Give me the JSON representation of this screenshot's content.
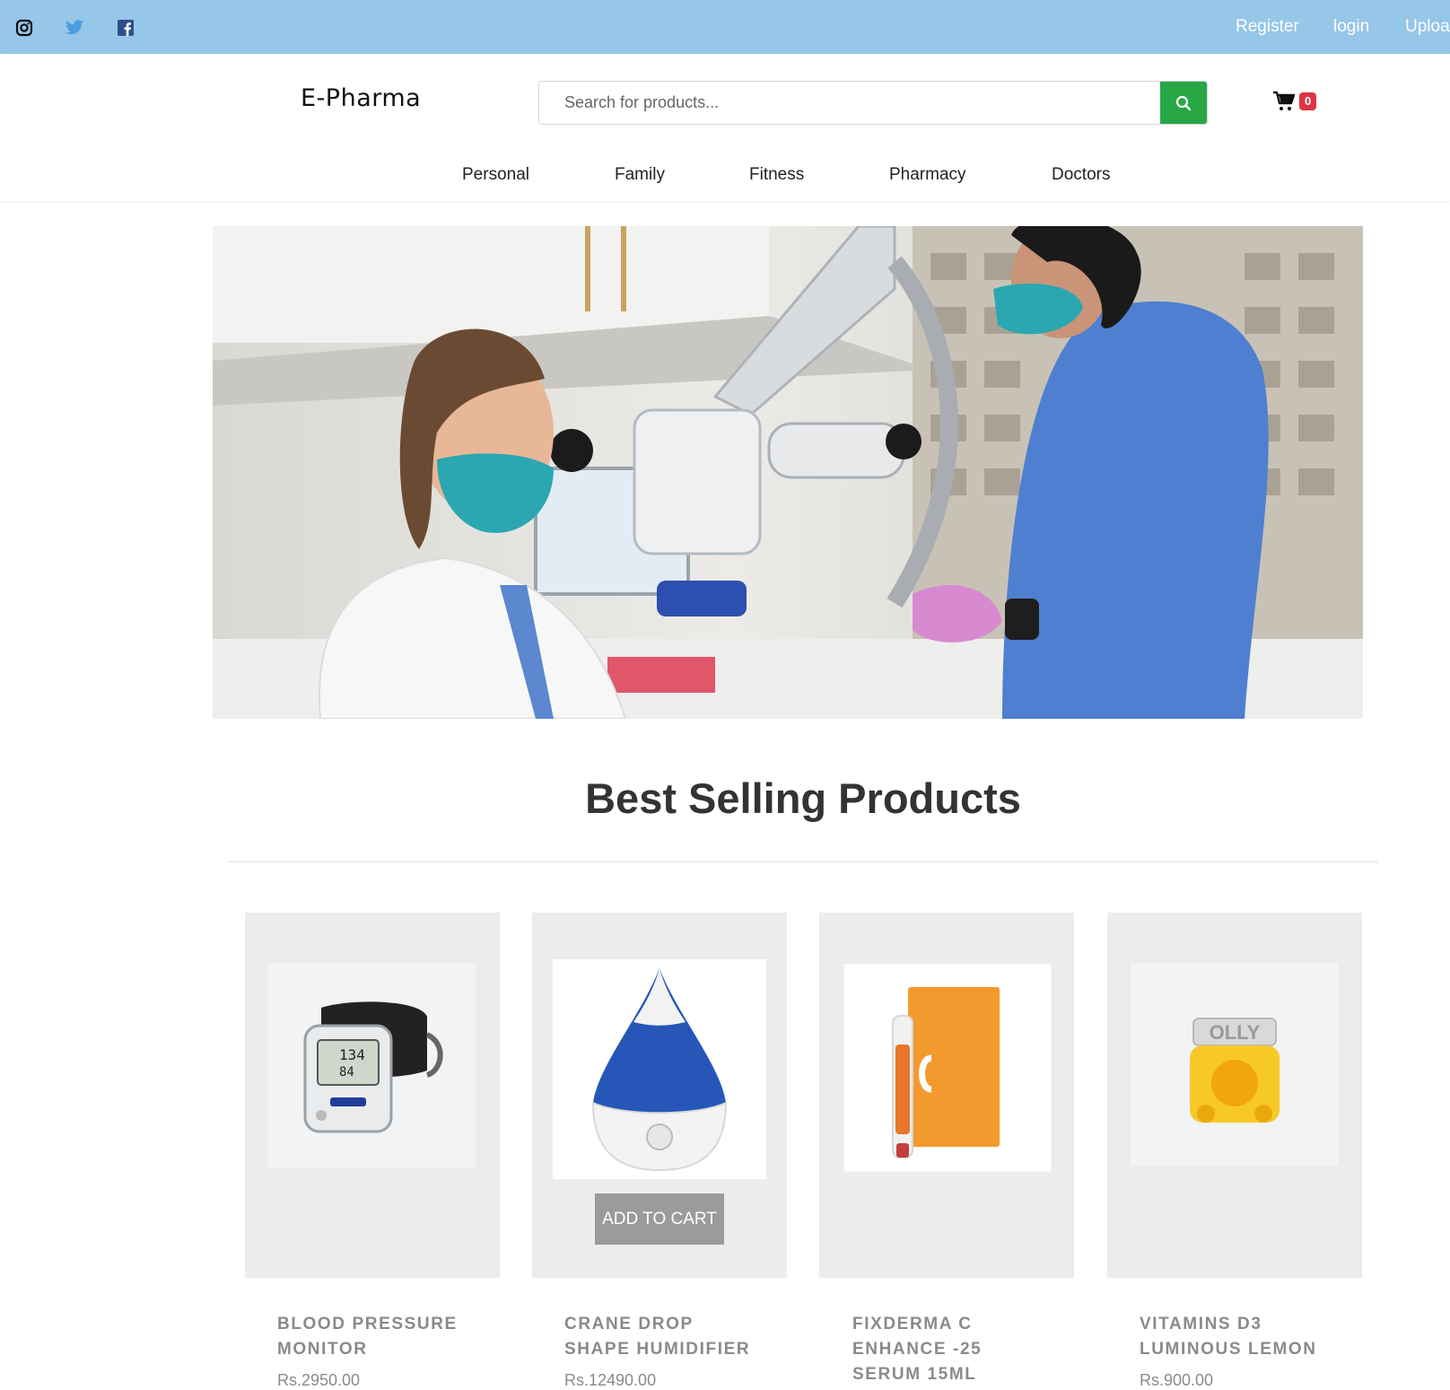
{
  "topbar": {
    "social_icons": [
      "instagram-icon",
      "twitter-icon",
      "facebook-icon"
    ],
    "links": [
      "Register",
      "login",
      "Uploa"
    ],
    "background": "#96c6e8"
  },
  "header": {
    "logo": "E-Pharma",
    "search": {
      "placeholder": "Search for products...",
      "value": ""
    },
    "search_button_icon": "search-icon",
    "cart_icon": "cart-icon",
    "cart_count": "0"
  },
  "nav": {
    "items": [
      "Personal",
      "Family",
      "Fitness",
      "Pharmacy",
      "Doctors"
    ]
  },
  "hero": {
    "image": "two clinicians in masks using a dental microscope"
  },
  "section": {
    "title": "Best Selling Products"
  },
  "products": [
    {
      "name_line1": "BLOOD PRESSURE",
      "name_line2": "MONITOR",
      "name_line3": "",
      "price": "Rs.2950.00",
      "image": "blood pressure monitor"
    },
    {
      "name_line1": "CRANE DROP",
      "name_line2": "SHAPE HUMIDIFIER",
      "name_line3": "",
      "price": "Rs.12490.00",
      "image": "drop shaped humidifier",
      "add_to_cart": "ADD TO CART"
    },
    {
      "name_line1": "FIXDERMA C",
      "name_line2": "ENHANCE -25",
      "name_line3": "SERUM 15ML",
      "price": "",
      "image": "serum box and bottle"
    },
    {
      "name_line1": "VITAMINS D3",
      "name_line2": "LUMINOUS LEMON",
      "name_line3": "",
      "price": "Rs.900.00",
      "image": "vitamin gummies jar"
    }
  ],
  "colors": {
    "accent_green": "#28a745",
    "badge_red": "#dc3545",
    "card_bg": "#ececec",
    "muted_text": "#8a8a8a"
  }
}
